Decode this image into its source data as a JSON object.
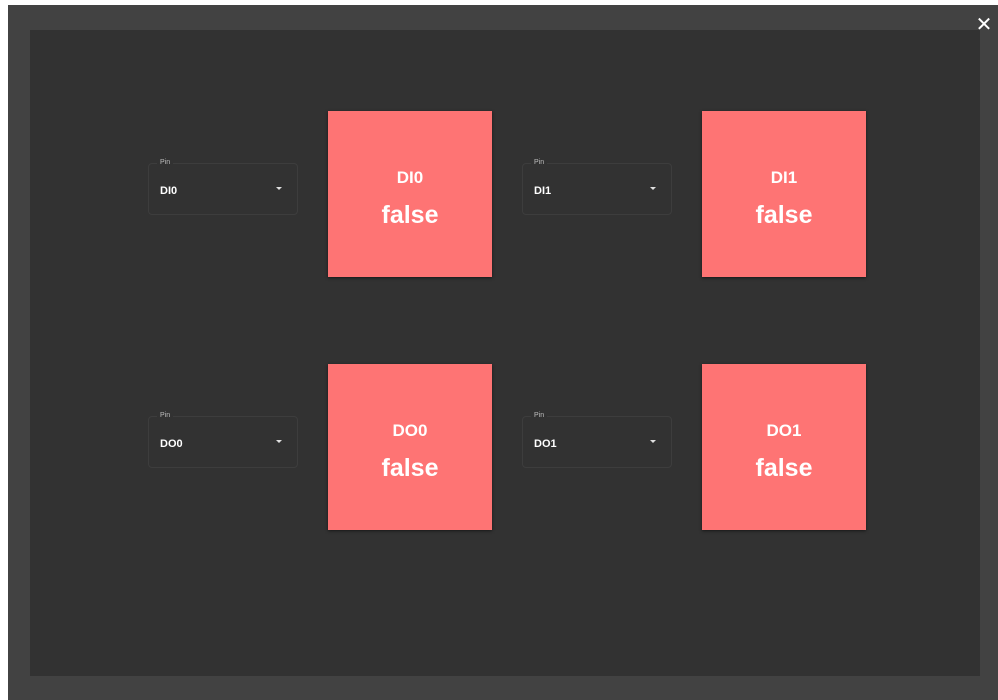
{
  "window": {
    "close_glyph": "✕"
  },
  "colors": {
    "frame_bg": "#424242",
    "panel_bg": "#323232",
    "tile_false": "#fe7474",
    "text": "#ffffff"
  },
  "channels": [
    {
      "pin_label": "Pin",
      "pin_value": "DI0",
      "tile_name": "DI0",
      "tile_state": "false"
    },
    {
      "pin_label": "Pin",
      "pin_value": "DI1",
      "tile_name": "DI1",
      "tile_state": "false"
    },
    {
      "pin_label": "Pin",
      "pin_value": "DO0",
      "tile_name": "DO0",
      "tile_state": "false"
    },
    {
      "pin_label": "Pin",
      "pin_value": "DO1",
      "tile_name": "DO1",
      "tile_state": "false"
    }
  ]
}
